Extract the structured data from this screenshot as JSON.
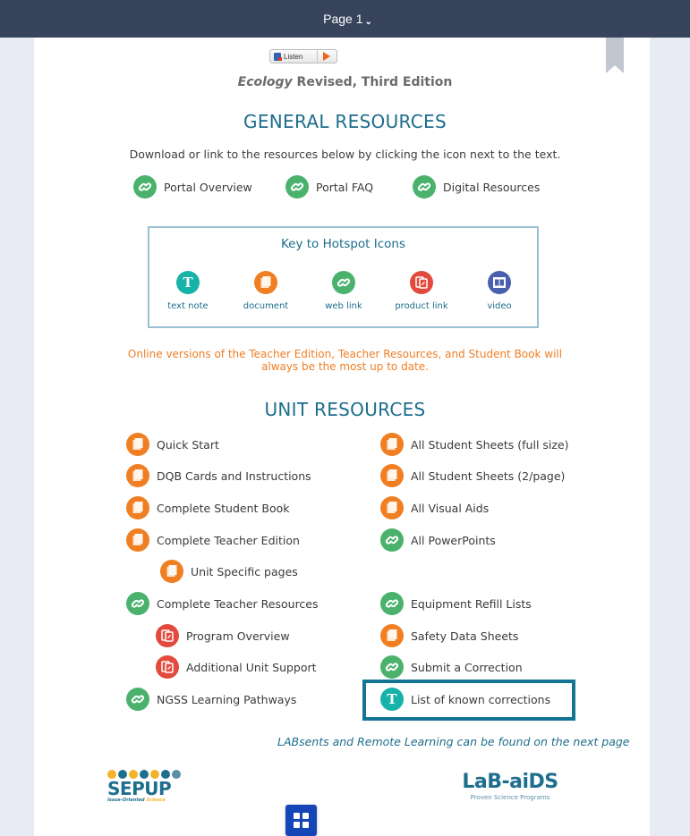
{
  "topbar": {
    "page_label": "Page 1",
    "chevron": "chevron-down-icon"
  },
  "listen_button": {
    "label": "Listen",
    "speaker_icon": "speaker-icon",
    "play_icon": "play-icon"
  },
  "book_title": {
    "italic": "Ecology",
    "rest": " Revised, Third Edition"
  },
  "general": {
    "heading": "GENERAL RESOURCES",
    "instructions": "Download or link to the resources below by clicking the icon next to the text.",
    "links": [
      {
        "label": "Portal Overview",
        "icon": "web-link-icon",
        "color": "#4bb26d"
      },
      {
        "label": "Portal FAQ",
        "icon": "web-link-icon",
        "color": "#4bb26d"
      },
      {
        "label": "Digital Resources",
        "icon": "web-link-icon",
        "color": "#4bb26d"
      }
    ]
  },
  "key": {
    "title": "Key to Hotspot Icons",
    "items": [
      {
        "label": "text note",
        "icon": "text-note-icon",
        "color": "#17b3a8"
      },
      {
        "label": "document",
        "icon": "document-icon",
        "color": "#ef7f22"
      },
      {
        "label": "web link",
        "icon": "web-link-icon",
        "color": "#4bb26d"
      },
      {
        "label": "product link",
        "icon": "product-link-icon",
        "color": "#e24a3d"
      },
      {
        "label": "video",
        "icon": "video-icon",
        "color": "#4a5fad"
      }
    ]
  },
  "notice": {
    "line1": "Online versions of the Teacher Edition, Teacher Resources, and Student Book will",
    "line2": "always be the most up to date."
  },
  "unit": {
    "heading": "UNIT RESOURCES",
    "left": [
      {
        "label": "Quick Start",
        "icon": "document-icon"
      },
      {
        "label": "DQB Cards and Instructions",
        "icon": "document-icon"
      },
      {
        "label": "Complete Student Book",
        "icon": "document-icon"
      },
      {
        "label": "Complete Teacher Edition",
        "icon": "document-icon"
      },
      {
        "label": "Unit Specific pages",
        "icon": "document-icon"
      },
      {
        "label": "Complete Teacher Resources",
        "icon": "web-link-icon"
      },
      {
        "label": "Program Overview",
        "icon": "product-link-icon"
      },
      {
        "label": "Additional Unit Support",
        "icon": "product-link-icon"
      },
      {
        "label": "NGSS Learning Pathways",
        "icon": "web-link-icon"
      }
    ],
    "right": [
      {
        "label": "All Student Sheets (full size)",
        "icon": "document-icon"
      },
      {
        "label": "All Student Sheets (2/page)",
        "icon": "document-icon"
      },
      {
        "label": "All Visual Aids",
        "icon": "document-icon"
      },
      {
        "label": "All PowerPoints",
        "icon": "web-link-icon"
      },
      {
        "label": "Equipment Refill Lists",
        "icon": "web-link-icon"
      },
      {
        "label": "Safety Data Sheets",
        "icon": "document-icon"
      },
      {
        "label": "Submit a Correction",
        "icon": "web-link-icon"
      },
      {
        "label": "List of known corrections",
        "icon": "text-note-icon"
      }
    ]
  },
  "labsents_note": "LABsents and Remote Learning can be found on the next page",
  "logos": {
    "sepup": {
      "word": "SEPUP",
      "tag_a": "Issue-Oriented ",
      "tag_b": "Science"
    },
    "labaids": {
      "word": "LaB-aiDS",
      "tag": "Proven Science Programs"
    }
  },
  "colors": {
    "accent": "#1d6d8c",
    "topbar": "#37445c",
    "highlight": "#137494",
    "notice": "#ee7e24"
  }
}
